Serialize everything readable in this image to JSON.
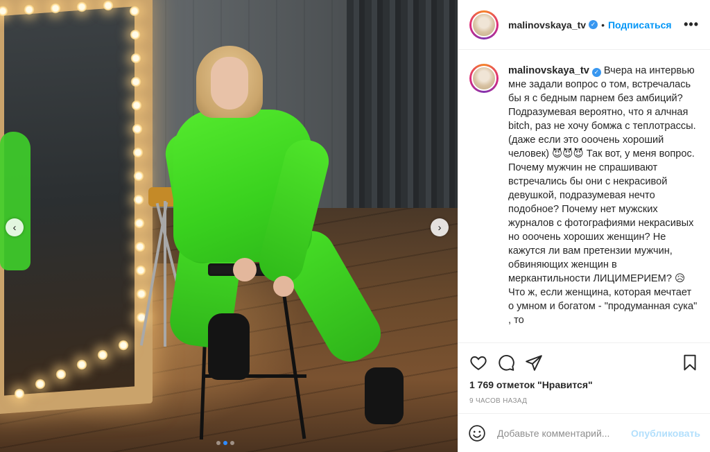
{
  "post": {
    "username": "malinovskaya_tv",
    "separator": "•",
    "follow_label": "Подписаться",
    "more_label": "•••",
    "caption": "Вчера на интервью мне задали вопрос о том, встречалась бы я с бедным парнем без амбиций? Подразумевая вероятно, что я алчная bitch, раз не хочу бомжа с теплотрассы. (даже если это ооочень хороший человек) 😈😈😈 Так вот, у меня вопрос. Почему мужчин не спрашивают встречались бы они с некрасивой девушкой, подразумевая нечто подобное? Почему нет мужских журналов с фотографиями некрасивых но ооочень хороших женщин? Не кажутся ли вам претензии мужчин, обвиняющих женщин в меркантильности ЛИЦИМЕРИЕМ? 😥 Что ж, если женщина, которая мечтает о умном и богатом - \"продуманная сука\" , то",
    "likes": "1 769 отметок \"Нравится\"",
    "time": "9 часов назад",
    "comment_placeholder": "Добавьте комментарий...",
    "publish_label": "Опубликовать"
  },
  "carousel": {
    "prev_label": "‹",
    "next_label": "›",
    "slide_count": 3,
    "active_slide": 2
  },
  "colors": {
    "accent": "#0095f6",
    "publish_disabled": "#b2dffc",
    "verified": "#3897f0",
    "outfit": "#3fd02a"
  },
  "icons": [
    "heart-icon",
    "comment-icon",
    "share-icon",
    "bookmark-icon",
    "emoji-icon",
    "verified-icon",
    "more-icon"
  ]
}
